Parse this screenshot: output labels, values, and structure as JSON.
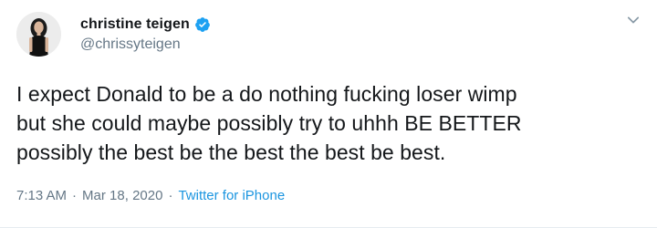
{
  "tweet": {
    "display_name": "christine teigen",
    "handle": "@chrissyteigen",
    "verified": true,
    "text": "I expect Donald to be a do nothing fucking loser wimp\nbut she could maybe possibly try to uhhh BE BETTER\npossibly the best be the best the best be best.",
    "time": "7:13 AM",
    "separator_1": "·",
    "date": "Mar 18, 2020",
    "separator_2": "·",
    "source": "Twitter for iPhone"
  },
  "icons": {
    "verified": "verified-badge-icon",
    "menu": "chevron-down-icon"
  },
  "colors": {
    "text_primary": "#14171a",
    "text_secondary": "#657786",
    "link": "#1b95e0",
    "verified": "#1da1f2"
  }
}
